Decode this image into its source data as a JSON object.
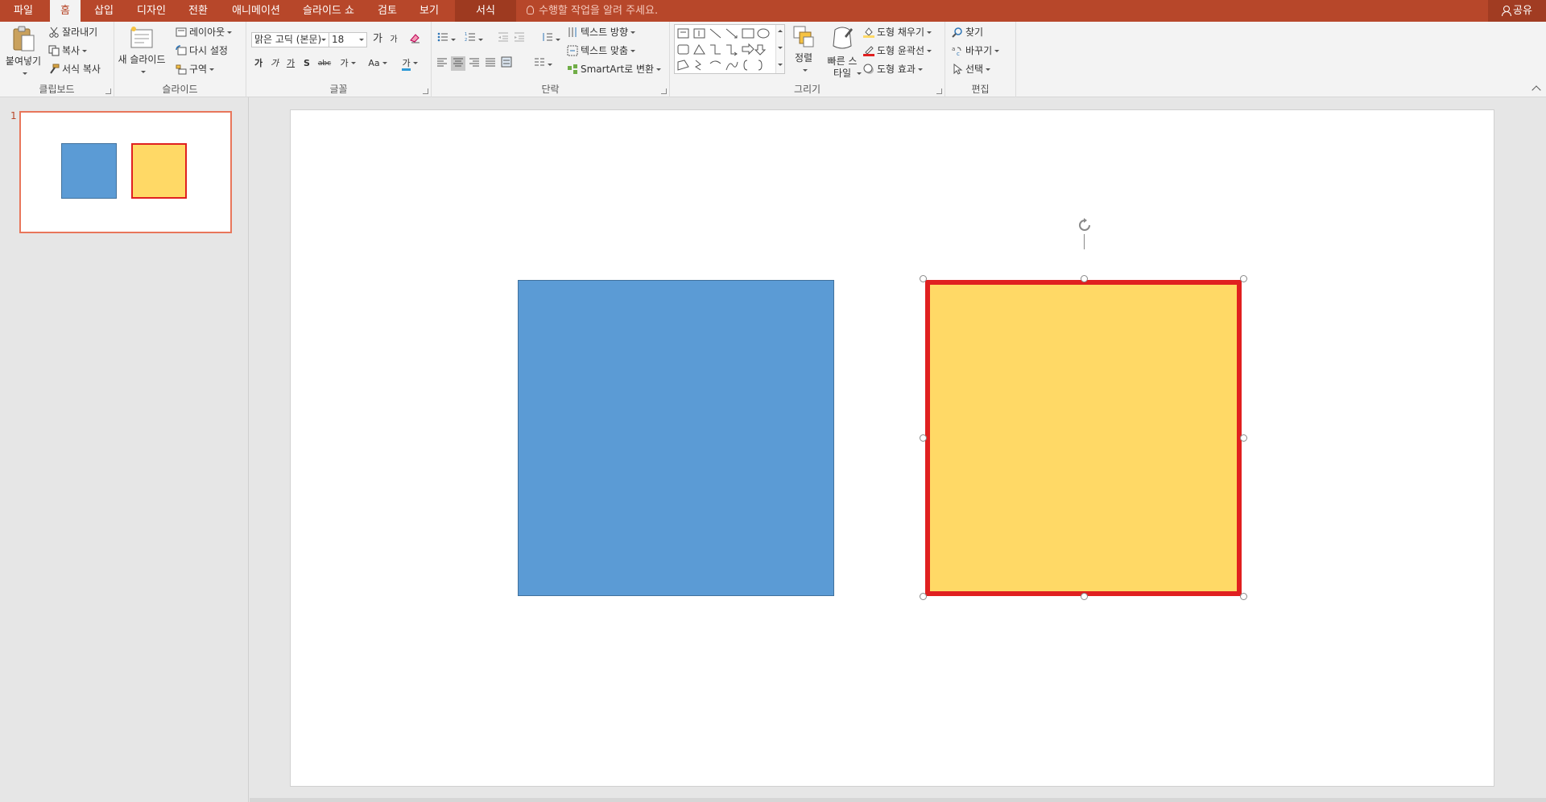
{
  "tabs": [
    {
      "label": "파일"
    },
    {
      "label": "홈"
    },
    {
      "label": "삽입"
    },
    {
      "label": "디자인"
    },
    {
      "label": "전환"
    },
    {
      "label": "애니메이션"
    },
    {
      "label": "슬라이드 쇼"
    },
    {
      "label": "검토"
    },
    {
      "label": "보기"
    },
    {
      "label": "서식"
    }
  ],
  "active_tab": "홈",
  "tell_me": "수행할 작업을 알려 주세요.",
  "share_label": "공유",
  "ribbon": {
    "clipboard": {
      "label": "클립보드",
      "paste": "붙여넣기",
      "cut": "잘라내기",
      "copy": "복사",
      "format_painter": "서식 복사"
    },
    "slides": {
      "label": "슬라이드",
      "new_slide": "새 슬라이드",
      "layout": "레이아웃",
      "reset": "다시 설정",
      "section": "구역"
    },
    "font": {
      "label": "글꼴",
      "font_name": "맑은 고딕 (본문)",
      "font_size": "18",
      "grow": "가",
      "shrink": "가",
      "bold": "가",
      "italic": "가",
      "underline": "가",
      "shadow": "S",
      "strike": "abc",
      "spacing": "가",
      "case": "Aa",
      "color": "가"
    },
    "paragraph": {
      "label": "단락",
      "text_direction": "텍스트 방향",
      "align_text": "텍스트 맞춤",
      "smartart": "SmartArt로 변환"
    },
    "drawing": {
      "label": "그리기",
      "arrange": "정렬",
      "quick_styles": "빠른 스타일",
      "fill": "도형 채우기",
      "outline": "도형 윤곽선",
      "effects": "도형 효과"
    },
    "editing": {
      "label": "편집",
      "find": "찾기",
      "replace": "바꾸기",
      "select": "선택"
    }
  },
  "slide_number": "1",
  "colors": {
    "accent": "#b7472a",
    "blue_fill": "#5b9bd5",
    "blue_border": "#41719c",
    "yellow_fill": "#ffd966",
    "red_outline": "#e02020",
    "outline_swatch": "#e02020",
    "fill_swatch": "#ffd966",
    "font_color_swatch": "#2e9ad6"
  }
}
